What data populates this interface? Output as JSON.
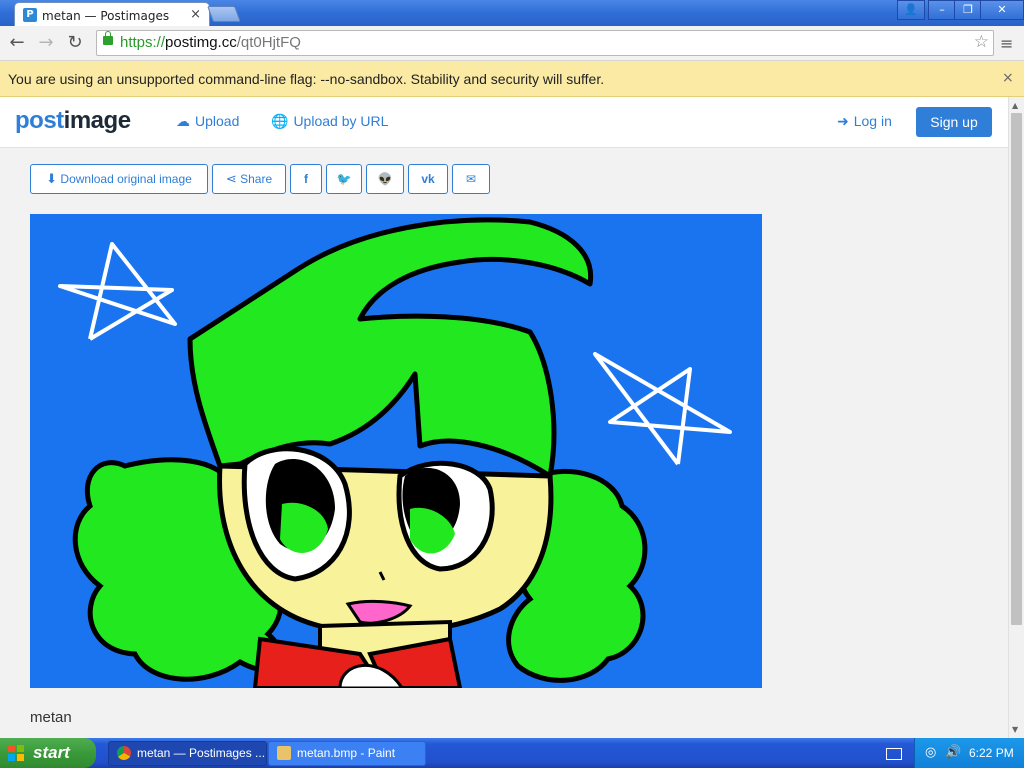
{
  "browser": {
    "tab_title": "metan — Postimages",
    "tab_favicon": "P",
    "url_scheme": "https://",
    "url_host": "postimg.cc",
    "url_path": "/qt0HjtFQ",
    "infobar_message": "You are using an unsupported command-line flag: --no-sandbox. Stability and security will suffer.",
    "infobar_close": "×"
  },
  "header": {
    "logo_a": "post",
    "logo_b": "image",
    "upload": "Upload",
    "upload_by_url": "Upload by URL",
    "login": "Log in",
    "signup": "Sign up"
  },
  "actions": {
    "download": "Download original image",
    "share": "Share"
  },
  "image": {
    "caption": "metan"
  },
  "taskbar": {
    "start": "start",
    "tasks": [
      {
        "label": "metan — Postimages ..."
      },
      {
        "label": "metan.bmp - Paint"
      }
    ],
    "clock": "6:22 PM"
  },
  "colors": {
    "accent": "#2f7ed8",
    "infobar": "#fbeaa4",
    "artwork_bg": "#1a74f0",
    "hair": "#22e81f",
    "skin": "#f8f29a"
  }
}
